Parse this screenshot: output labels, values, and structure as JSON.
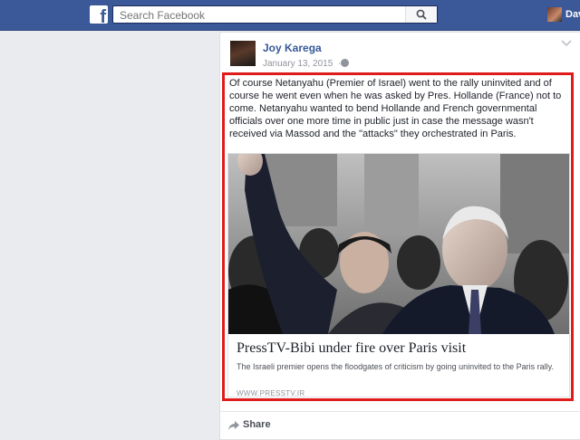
{
  "topbar": {
    "logo_letter": "f",
    "search_placeholder": "Search Facebook",
    "user_name": "Dav"
  },
  "post": {
    "author": "Joy Karega",
    "date": "January 13, 2015",
    "date_separator": "·",
    "text": "Of course Netanyahu (Premier of Israel) went to the rally uninvited and of course he went even when he was asked by Pres. Hollande (France) not to come. Netanyahu wanted to bend Hollande and French governmental officials over one more time in public just in case the message wasn't received via Massod and the \"attacks\" they orchestrated in Paris.",
    "link": {
      "title": "PressTV-Bibi under fire over Paris visit",
      "description": "The Israeli premier opens the floodgates of criticism by going uninvited to the Paris rally.",
      "domain": "WWW.PRESSTV.IR"
    },
    "actions": {
      "share_label": "Share"
    }
  },
  "colors": {
    "brand": "#3b5998",
    "link_blue": "#365899",
    "highlight_red": "#e01b1b",
    "page_bg": "#e9ebee"
  }
}
